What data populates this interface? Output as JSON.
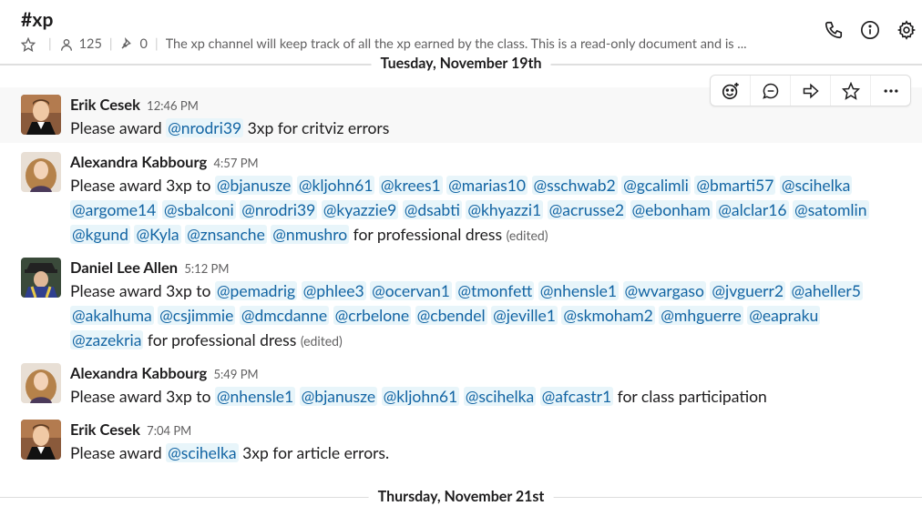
{
  "channel": {
    "name": "#xp",
    "members": "125",
    "pins": "0",
    "topic": "The xp channel will keep track of all the xp earned by the class. This is a read-only document and is ..."
  },
  "days": {
    "first": "Tuesday, November 19th",
    "second": "Thursday, November 21st"
  },
  "messages": [
    {
      "author": "Erik Cesek",
      "time": "12:46 PM",
      "pre": "Please award",
      "mentions": [
        "@nrodri39"
      ],
      "post": "3xp for critviz errors",
      "edited": ""
    },
    {
      "author": "Alexandra Kabbourg",
      "time": "4:57 PM",
      "pre": "Please award 3xp to",
      "mentions": [
        "@bjanusze",
        "@kljohn61",
        "@krees1",
        "@marias10",
        "@sschwab2",
        "@gcalimli",
        "@bmarti57",
        "@scihelka",
        "@argome14",
        "@sbalconi",
        "@nrodri39",
        "@kyazzie9",
        "@dsabti",
        "@khyazzi1",
        "@acrusse2",
        "@ebonham",
        "@alclar16",
        "@satomlin",
        "@kgund",
        "@Kyla",
        "@znsanche",
        "@nmushro"
      ],
      "post": "for professional dress",
      "edited": "(edited)"
    },
    {
      "author": "Daniel Lee Allen",
      "time": "5:12 PM",
      "pre": "Please award 3xp to",
      "mentions": [
        "@pemadrig",
        "@phlee3",
        "@ocervan1",
        "@tmonfett",
        "@nhensle1",
        "@wvargaso",
        "@jvguerr2",
        "@aheller5",
        "@akalhuma",
        "@csjimmie",
        "@dmcdanne",
        "@crbelone",
        "@cbendel",
        "@jeville1",
        "@skmoham2",
        "@mhguerre",
        "@eapraku",
        "@zazekria"
      ],
      "post": "for professional dress",
      "edited": "(edited)"
    },
    {
      "author": "Alexandra Kabbourg",
      "time": "5:49 PM",
      "pre": "Please award 3xp to",
      "mentions": [
        "@nhensle1",
        "@bjanusze",
        "@kljohn61",
        "@scihelka",
        "@afcastr1"
      ],
      "post": "for class participation",
      "edited": ""
    },
    {
      "author": "Erik Cesek",
      "time": "7:04 PM",
      "pre": "Please award",
      "mentions": [
        "@scihelka"
      ],
      "post": "3xp for article errors.",
      "edited": ""
    }
  ]
}
